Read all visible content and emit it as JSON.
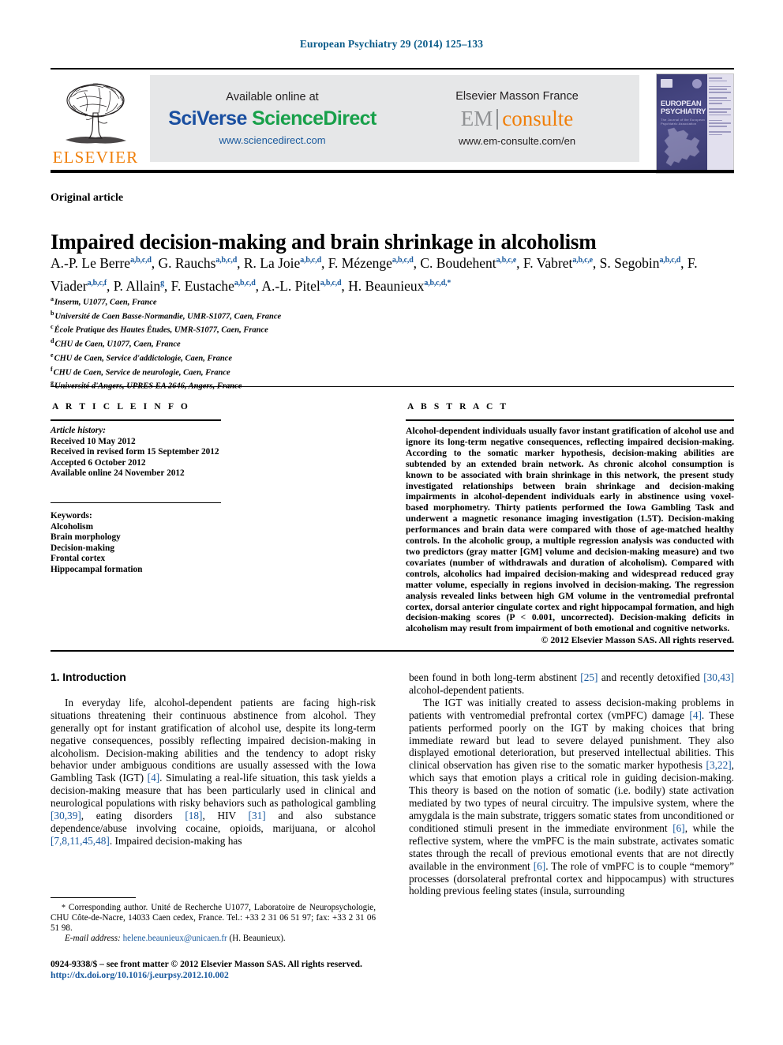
{
  "running_head": "European Psychiatry 29 (2014) 125–133",
  "masthead": {
    "publisher_logo_text": "ELSEVIER",
    "available_online_label": "Available online at",
    "sciencedirect_brand_part1": "SciVerse ",
    "sciencedirect_brand_part2": "ScienceDirect",
    "sciencedirect_url": "www.sciencedirect.com",
    "masson_label": "Elsevier Masson France",
    "em_brand_part1": "EM",
    "em_brand_part2": "consulte",
    "em_url": "www.em-consulte.com/en",
    "cover_title_line1": "EUROPEAN",
    "cover_title_line2": "PSYCHIATRY",
    "cover_subtitle": "The Journal of the European Psychiatric Association"
  },
  "article": {
    "type": "Original article",
    "title": "Impaired decision-making and brain shrinkage in alcoholism",
    "authors_line1": "A.-P. Le Berre ",
    "authors": [
      {
        "name": "A.-P. Le Berre",
        "marks": "a,b,c,d"
      },
      {
        "name": "G. Rauchs",
        "marks": "a,b,c,d"
      },
      {
        "name": "R. La Joie",
        "marks": "a,b,c,d"
      },
      {
        "name": "F. Mézenge",
        "marks": "a,b,c,d"
      },
      {
        "name": "C. Boudehent",
        "marks": "a,b,c,e"
      },
      {
        "name": "F. Vabret",
        "marks": "a,b,c,e"
      },
      {
        "name": "S. Segobin",
        "marks": "a,b,c,d"
      },
      {
        "name": "F. Viader",
        "marks": "a,b,c,f"
      },
      {
        "name": "P. Allain",
        "marks": "g"
      },
      {
        "name": "F. Eustache",
        "marks": "a,b,c,d"
      },
      {
        "name": "A.-L. Pitel",
        "marks": "a,b,c,d"
      },
      {
        "name": "H. Beaunieux",
        "marks": "a,b,c,d,*"
      }
    ],
    "affiliations": [
      {
        "mark": "a",
        "text": "Inserm, U1077, Caen, France"
      },
      {
        "mark": "b",
        "text": "Université de Caen Basse-Normandie, UMR-S1077, Caen, France"
      },
      {
        "mark": "c",
        "text": "École Pratique des Hautes Études, UMR-S1077, Caen, France"
      },
      {
        "mark": "d",
        "text": "CHU de Caen, U1077, Caen, France"
      },
      {
        "mark": "e",
        "text": "CHU de Caen, Service d'addictologie, Caen, France"
      },
      {
        "mark": "f",
        "text": "CHU de Caen, Service de neurologie, Caen, France"
      },
      {
        "mark": "g",
        "text": "Université d'Angers, UPRES EA 2646, Angers, France"
      }
    ]
  },
  "article_info": {
    "heading": "A R T I C L E   I N F O",
    "history_label": "Article history:",
    "history": [
      "Received 10 May 2012",
      "Received in revised form 15 September 2012",
      "Accepted 6 October 2012",
      "Available online 24 November 2012"
    ],
    "keywords_label": "Keywords:",
    "keywords": [
      "Alcoholism",
      "Brain morphology",
      "Decision-making",
      "Frontal cortex",
      "Hippocampal formation"
    ]
  },
  "abstract": {
    "heading": "A B S T R A C T",
    "text": "Alcohol-dependent individuals usually favor instant gratification of alcohol use and ignore its long-term negative consequences, reflecting impaired decision-making. According to the somatic marker hypothesis, decision-making abilities are subtended by an extended brain network. As chronic alcohol consumption is known to be associated with brain shrinkage in this network, the present study investigated relationships between brain shrinkage and decision-making impairments in alcohol-dependent individuals early in abstinence using voxel-based morphometry. Thirty patients performed the Iowa Gambling Task and underwent a magnetic resonance imaging investigation (1.5T). Decision-making performances and brain data were compared with those of age-matched healthy controls. In the alcoholic group, a multiple regression analysis was conducted with two predictors (gray matter [GM] volume and decision-making measure) and two covariates (number of withdrawals and duration of alcoholism). Compared with controls, alcoholics had impaired decision-making and widespread reduced gray matter volume, especially in regions involved in decision-making. The regression analysis revealed links between high GM volume in the ventromedial prefrontal cortex, dorsal anterior cingulate cortex and right hippocampal formation, and high decision-making scores (P < 0.001, uncorrected). Decision-making deficits in alcoholism may result from impairment of both emotional and cognitive networks.",
    "copyright": "© 2012 Elsevier Masson SAS. All rights reserved."
  },
  "body": {
    "section_heading": "1. Introduction",
    "left_paragraph_1_a": "In everyday life, alcohol-dependent patients are facing high-risk situations threatening their continuous abstinence from alcohol. They generally opt for instant gratification of alcohol use, despite its long-term negative consequences, possibly reflecting impaired decision-making in alcoholism. Decision-making abilities and the tendency to adopt risky behavior under ambiguous conditions are usually assessed with the Iowa Gambling Task (IGT) ",
    "ref_igt": "[4]",
    "left_paragraph_1_b": ". Simulating a real-life situation, this task yields a decision-making measure that has been particularly used in clinical and neurological populations with risky behaviors such as pathological gambling ",
    "ref_gambling": "[30,39]",
    "left_paragraph_1_c": ", eating disorders ",
    "ref_eating": "[18]",
    "left_paragraph_1_d": ", HIV ",
    "ref_hiv": "[31]",
    "left_paragraph_1_e": " and also substance dependence/abuse involving cocaine, opioids, marijuana, or alcohol ",
    "ref_substance": "[7,8,11,45,48]",
    "left_paragraph_1_f": ". Impaired decision-making has",
    "right_paragraph_1_a": "been found in both long-term abstinent ",
    "ref_abstinent": "[25]",
    "right_paragraph_1_b": " and recently detoxified ",
    "ref_detox": "[30,43]",
    "right_paragraph_1_c": " alcohol-dependent patients.",
    "right_paragraph_2_a": "The IGT was initially created to assess decision-making problems in patients with ventromedial prefrontal cortex (vmPFC) damage ",
    "ref_vmpfc": "[4]",
    "right_paragraph_2_b": ". These patients performed poorly on the IGT by making choices that bring immediate reward but lead to severe delayed punishment. They also displayed emotional deterioration, but preserved intellectual abilities. This clinical observation has given rise to the somatic marker hypothesis ",
    "ref_smh": "[3,22]",
    "right_paragraph_2_c": ", which says that emotion plays a critical role in guiding decision-making. This theory is based on the notion of somatic (i.e. bodily) state activation mediated by two types of neural circuitry. The impulsive system, where the amygdala is the main substrate, triggers somatic states from unconditioned or conditioned stimuli present in the immediate environment ",
    "ref_env1": "[6]",
    "right_paragraph_2_d": ", while the reflective system, where the vmPFC is the main substrate, activates somatic states through the recall of previous emotional events that are not directly available in the environment ",
    "ref_env2": "[6]",
    "right_paragraph_2_e": ". The role of vmPFC is to couple “memory” processes (dorsolateral prefrontal cortex and hippocampus) with structures holding previous feeling states (insula, surrounding"
  },
  "footnote": {
    "star": "*",
    "corresponding_text": " Corresponding author. Unité de Recherche U1077, Laboratoire de Neuropsychologie, CHU Côte-de-Nacre, 14033 Caen cedex, France. Tel.: +33 2 31 06 51 97; fax: +33 2 31 06 51 98.",
    "email_label": "E-mail address:",
    "email": "helene.beaunieux@unicaen.fr",
    "email_owner": " (H. Beaunieux)."
  },
  "frontmatter": {
    "line": "0924-9338/$ – see front matter © 2012 Elsevier Masson SAS. All rights reserved.",
    "doi": "http://dx.doi.org/10.1016/j.eurpsy.2012.10.002"
  },
  "colors": {
    "journal_blue": "#0b5c8a",
    "link_blue": "#1a5a9e",
    "elsevier_orange": "#f07f09",
    "sciencedirect_green": "#18a04a",
    "sciencedirect_blue": "#1a4fa0",
    "banner_gray": "#e6e7e8"
  }
}
